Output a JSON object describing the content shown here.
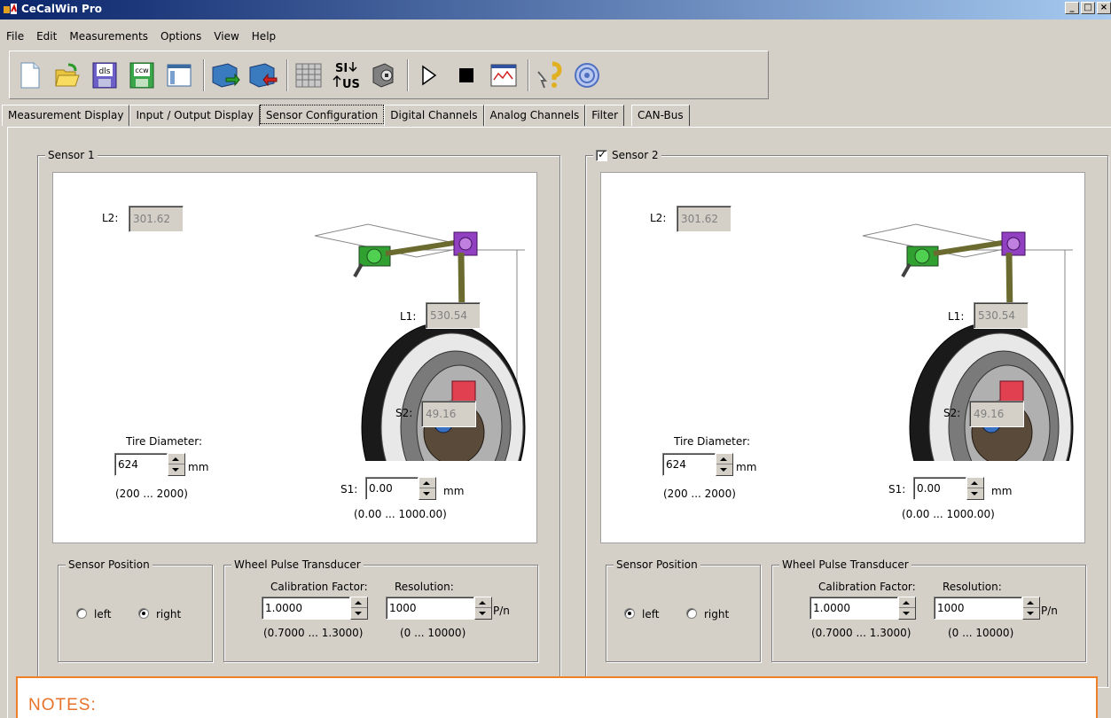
{
  "window": {
    "title": "CeCalWin Pro",
    "buttons": [
      "_",
      "□",
      "×"
    ]
  },
  "menu": [
    "File",
    "Edit",
    "Measurements",
    "Options",
    "View",
    "Help"
  ],
  "toolbar": {
    "icons": [
      "new-file-icon",
      "open-folder-icon",
      "save-dls-icon",
      "save-ccw-icon",
      "layout-icon",
      "import-icon",
      "export-icon",
      "grid-table-icon",
      "si-us-units-icon",
      "sensor-settings-icon",
      "play-icon",
      "stop-icon",
      "chart-window-icon",
      "help-icon",
      "about-icon"
    ],
    "dls_label": "dls",
    "ccw_label": "ccw",
    "si_label": "SI",
    "us_label": "US"
  },
  "tabs": [
    "Measurement Display",
    "Input / Output Display",
    "Sensor Configuration",
    "Digital Channels",
    "Analog Channels",
    "Filter",
    "CAN-Bus"
  ],
  "active_tab": "Sensor Configuration",
  "sensors": [
    {
      "title": "Sensor 1",
      "checkbox": false,
      "L2_label": "L2:",
      "L2": "301.62",
      "L1_label": "L1:",
      "L1": "530.54",
      "S2_label": "S2:",
      "S2": "49.16",
      "S1_label": "S1:",
      "S1": "0.00",
      "S1_unit": "mm",
      "S1_range": "(0.00 ... 1000.00)",
      "tire_label": "Tire Diameter:",
      "tire": "624",
      "tire_unit": "mm",
      "tire_range": "(200 ... 2000)",
      "position_title": "Sensor Position",
      "left_label": "left",
      "right_label": "right",
      "position": "right",
      "wpt_title": "Wheel Pulse Transducer",
      "cal_label": "Calibration Factor:",
      "cal": "1.0000",
      "cal_range": "(0.7000 ... 1.3000)",
      "res_label": "Resolution:",
      "res": "1000",
      "res_unit": "P/n",
      "res_range": "(0 ... 10000)"
    },
    {
      "title": "Sensor 2",
      "checkbox": true,
      "L2_label": "L2:",
      "L2": "301.62",
      "L1_label": "L1:",
      "L1": "530.54",
      "S2_label": "S2:",
      "S2": "49.16",
      "S1_label": "S1:",
      "S1": "0.00",
      "S1_unit": "mm",
      "S1_range": "(0.00 ... 1000.00)",
      "tire_label": "Tire Diameter:",
      "tire": "624",
      "tire_unit": "mm",
      "tire_range": "(200 ... 2000)",
      "position_title": "Sensor Position",
      "left_label": "left",
      "right_label": "right",
      "position": "left",
      "wpt_title": "Wheel Pulse Transducer",
      "cal_label": "Calibration Factor:",
      "cal": "1.0000",
      "cal_range": "(0.7000 ... 1.3000)",
      "res_label": "Resolution:",
      "res": "1000",
      "res_unit": "P/n",
      "res_range": "(0 ... 10000)"
    }
  ],
  "notes": {
    "label": "NOTES:"
  },
  "colors": {
    "title_gradient_start": "#0a246a",
    "title_gradient_end": "#a6caf0",
    "face": "#d4d0c8",
    "notes_border": "#f07f2a",
    "notes_text": "#e8722a"
  }
}
